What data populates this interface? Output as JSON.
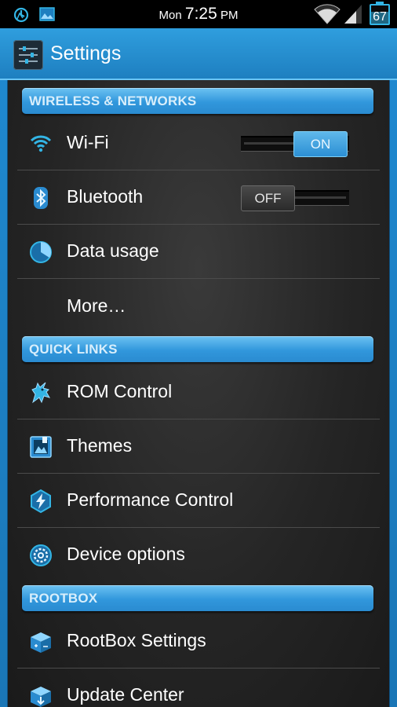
{
  "status_bar": {
    "day": "Mon",
    "time": "7:25",
    "ampm": "PM",
    "battery": "67",
    "battery_level": 0.67,
    "left_icons": [
      "alarm-sync-icon",
      "image-icon"
    ],
    "right_icons": [
      "wifi-icon",
      "signal-icon"
    ]
  },
  "action_bar": {
    "title": "Settings",
    "icon": "settings-sliders-icon"
  },
  "colors": {
    "accent": "#33b5e5",
    "header_blue": "#2f9ede",
    "row_divider": "#4b4b4b"
  },
  "sections": {
    "wireless": "WIRELESS & NETWORKS",
    "quick_links": "QUICK LINKS",
    "rootbox": "ROOTBOX"
  },
  "rows": {
    "wifi": {
      "label": "Wi-Fi",
      "icon": "wifi-icon",
      "toggle": "ON"
    },
    "bluetooth": {
      "label": "Bluetooth",
      "icon": "bluetooth-icon",
      "toggle": "OFF"
    },
    "data_usage": {
      "label": "Data usage",
      "icon": "data-usage-icon"
    },
    "more": {
      "label": "More…"
    },
    "rom_control": {
      "label": "ROM Control",
      "icon": "unicorn-icon"
    },
    "themes": {
      "label": "Themes",
      "icon": "themes-icon"
    },
    "performance": {
      "label": "Performance Control",
      "icon": "performance-icon"
    },
    "device_options": {
      "label": "Device options",
      "icon": "gear-icon"
    },
    "rootbox_settings": {
      "label": "RootBox Settings",
      "icon": "rootbox-icon"
    },
    "update_center": {
      "label": "Update Center",
      "icon": "update-icon"
    }
  }
}
